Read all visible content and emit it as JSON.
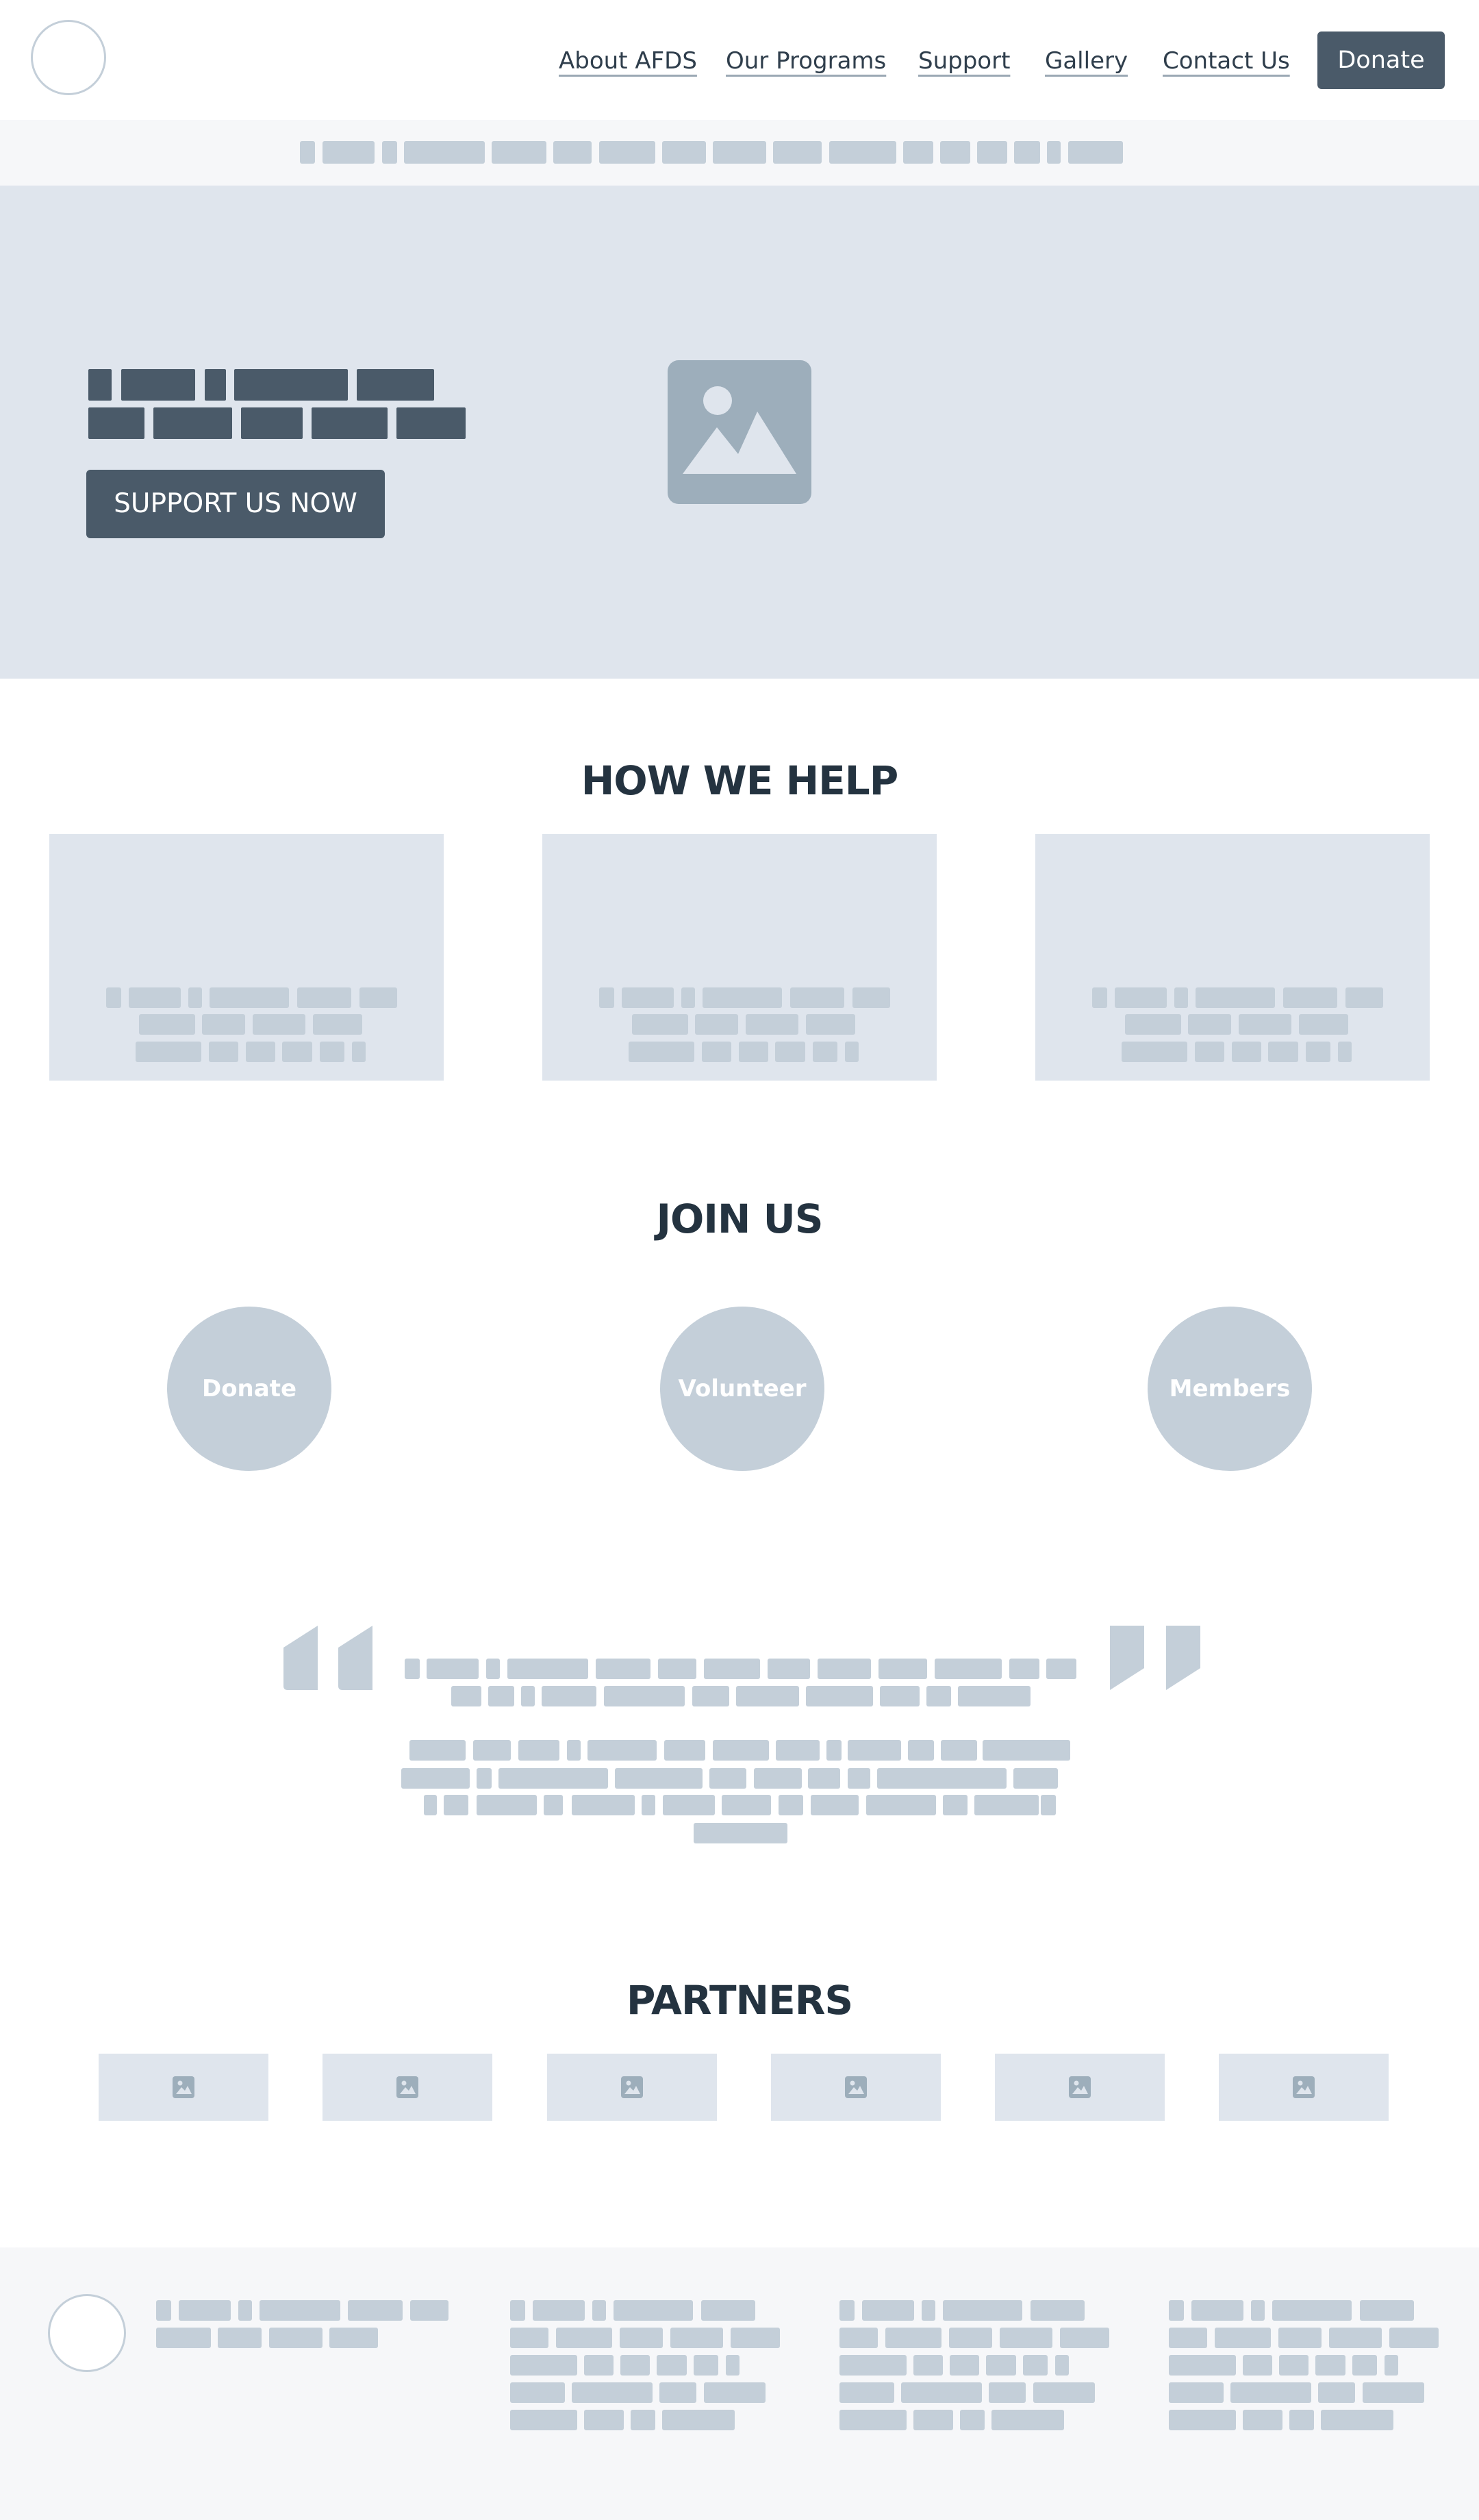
{
  "nav": {
    "items": [
      {
        "label": "About AFDS"
      },
      {
        "label": "Our Programs"
      },
      {
        "label": "Support"
      },
      {
        "label": "Gallery"
      },
      {
        "label": "Contact Us"
      }
    ],
    "donate_label": "Donate"
  },
  "hero": {
    "cta_label": "SUPPORT US NOW",
    "image_icon": "image-icon"
  },
  "help": {
    "title": "HOW WE HELP"
  },
  "join": {
    "title": "JOIN US",
    "items": [
      {
        "label": "Donate"
      },
      {
        "label": "Volunteer"
      },
      {
        "label": "Members"
      }
    ]
  },
  "testimonial": {
    "quote_icons": [
      "open-quote-icon",
      "close-quote-icon"
    ]
  },
  "partners": {
    "title": "PARTNERS",
    "logo_icon": "image-icon"
  },
  "colors": {
    "primary": "#4a5a69",
    "placeholder": "#c4cfd9",
    "panel": "#dfe5ed",
    "heading": "#243340",
    "muted_bg": "#f6f7f9"
  }
}
